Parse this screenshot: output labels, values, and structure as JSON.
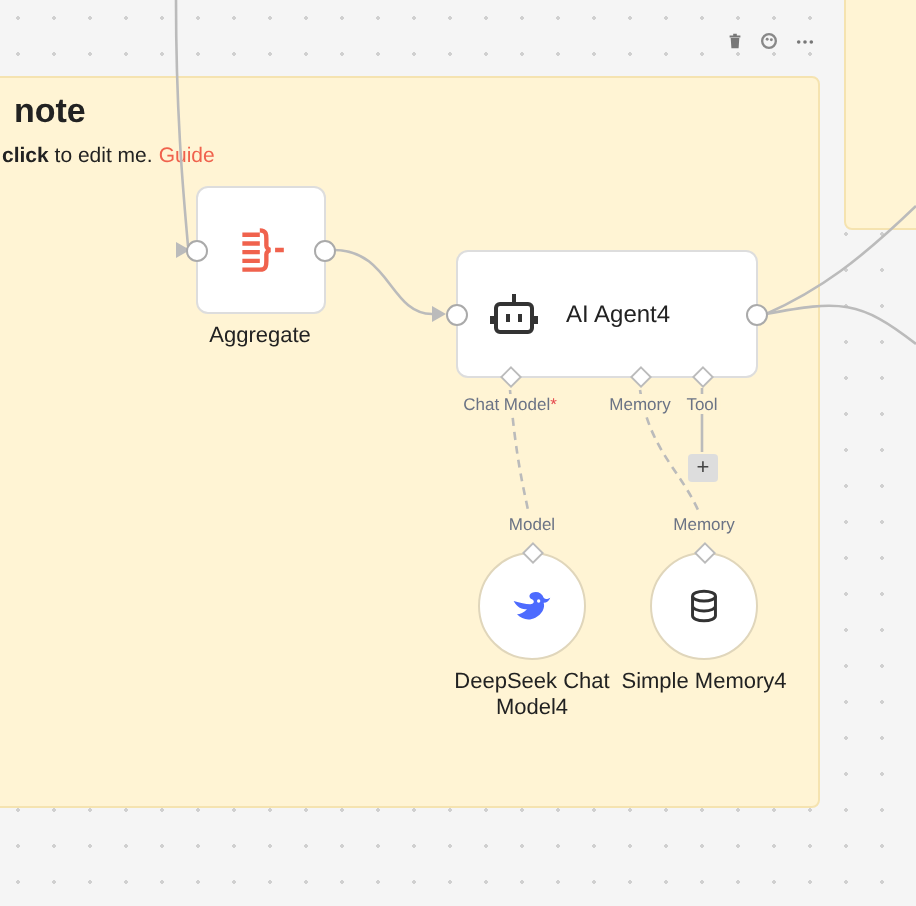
{
  "sticky_note": {
    "title": "note",
    "body": "**click** to edit me. ",
    "link": "Guide"
  },
  "nodes": [
    {
      "kind": "aggregate",
      "label": "Aggregate"
    },
    {
      "kind": "agent",
      "label": "AI Agent4",
      "ports": [
        {
          "label": "Chat Model",
          "required_mark": "*"
        },
        {
          "label": "Memory"
        },
        {
          "label": "Tool"
        }
      ]
    },
    {
      "kind": "model",
      "input_label": "Model",
      "label": "DeepSeek Chat Model4"
    },
    {
      "kind": "memory",
      "input_label": "Memory",
      "label": "Simple Memory4"
    }
  ],
  "add_tool_button": "+"
}
